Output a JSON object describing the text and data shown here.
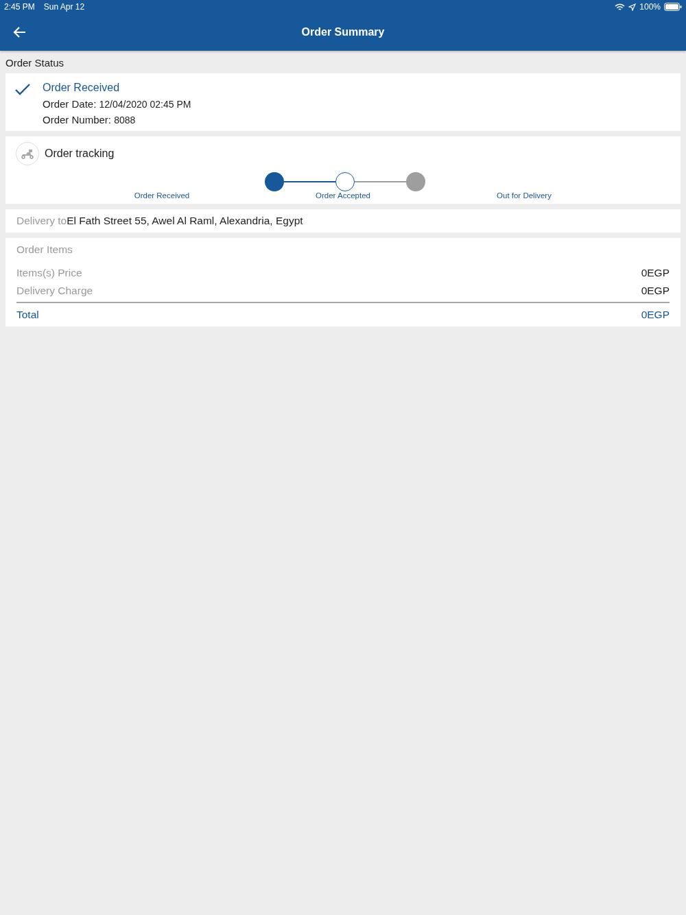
{
  "status_bar": {
    "time": "2:45 PM",
    "date": "Sun Apr 12",
    "battery": "100%"
  },
  "nav": {
    "title": "Order Summary"
  },
  "order_status": {
    "heading": "Order Status",
    "status": "Order Received",
    "date_label": "Order Date:",
    "date": "12/04/2020 02:45 PM",
    "number_label": "Order Number:",
    "number": "8088"
  },
  "tracking": {
    "title": "Order tracking",
    "steps": [
      {
        "label": "Order Received",
        "completed": true,
        "selected": false
      },
      {
        "label": "Order Accepted",
        "completed": false,
        "selected": true
      },
      {
        "label": "Out for Delivery",
        "completed": false,
        "selected": false
      }
    ]
  },
  "delivery": {
    "label": "Delivery to",
    "address": "El Fath Street 55, Awel Al Raml, Alexandria, Egypt"
  },
  "items": {
    "heading": "Order Items",
    "rows": [
      {
        "label": "Items(s) Price",
        "value": "0EGP"
      },
      {
        "label": "Delivery Charge",
        "value": "0EGP"
      }
    ],
    "total": {
      "label": "Total",
      "value": "0EGP"
    }
  }
}
